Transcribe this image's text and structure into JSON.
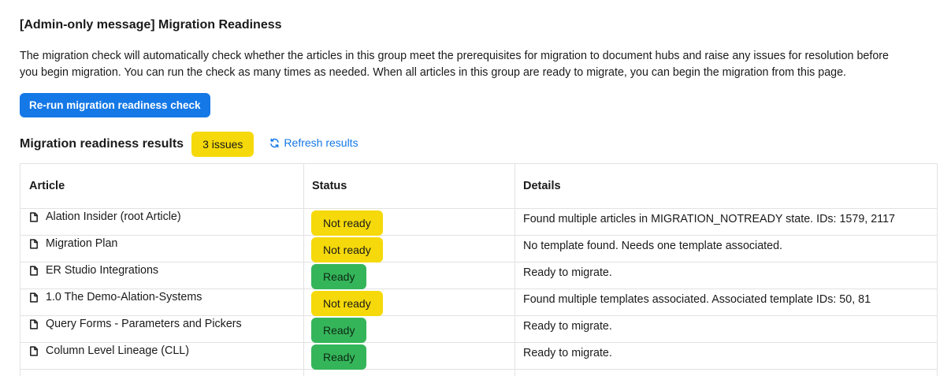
{
  "header": {
    "title": "[Admin-only message] Migration Readiness",
    "description_line1": "The migration check will automatically check whether the articles in this group meet the prerequisites for migration to document hubs and raise any issues for resolution before",
    "description_line2": "you begin migration. You can run the check as many times as needed. When all articles in this group are ready to migrate, you can begin the migration from this page."
  },
  "actions": {
    "rerun_label": "Re-run migration readiness check"
  },
  "results": {
    "title": "Migration readiness results",
    "issues_badge": "3 issues",
    "refresh_label": "Refresh results",
    "refresh_icon": "refresh-icon"
  },
  "table": {
    "columns": [
      "Article",
      "Status",
      "Details"
    ],
    "rows": [
      {
        "article": "Alation Insider (root Article)",
        "status": "Not ready",
        "details": "Found multiple articles in MIGRATION_NOTREADY state. IDs: 1579, 2117"
      },
      {
        "article": "Migration Plan",
        "status": "Not ready",
        "details": "No template found. Needs one template associated."
      },
      {
        "article": "ER Studio Integrations",
        "status": "Ready",
        "details": "Ready to migrate."
      },
      {
        "article": "1.0 The Demo-Alation-Systems",
        "status": "Not ready",
        "details": "Found multiple templates associated. Associated template IDs: 50, 81"
      },
      {
        "article": "Query Forms - Parameters and Pickers",
        "status": "Ready",
        "details": "Ready to migrate."
      },
      {
        "article": "Column Level Lineage (CLL)",
        "status": "Ready",
        "details": "Ready to migrate."
      }
    ]
  },
  "colors": {
    "primary": "#1478e6",
    "warning": "#f5d90a",
    "success": "#35b55a",
    "border": "#e2e2e2"
  }
}
